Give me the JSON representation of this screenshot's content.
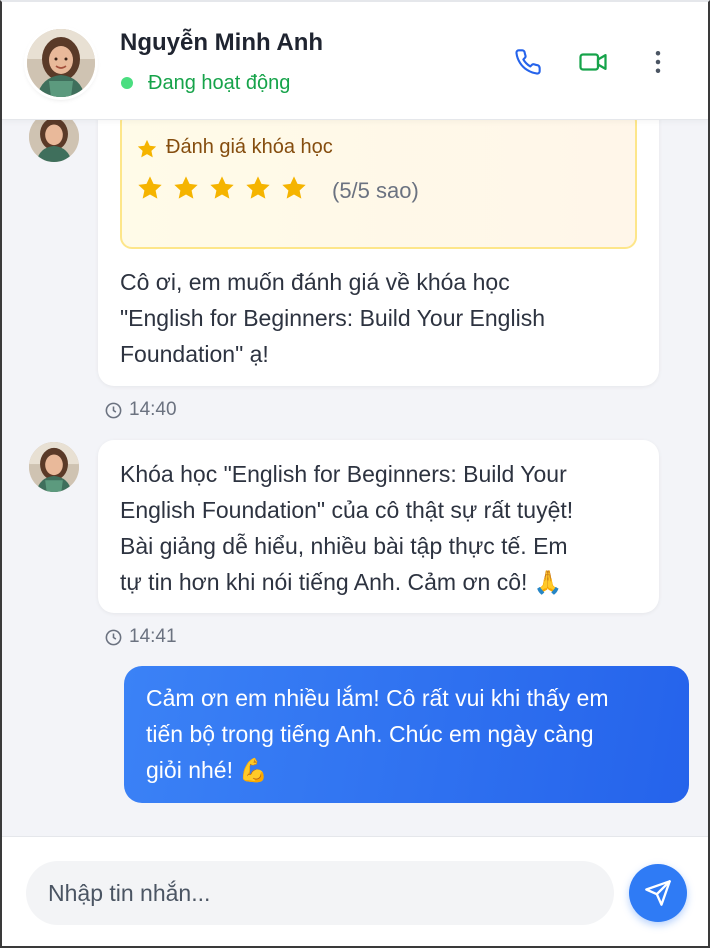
{
  "header": {
    "contact_name": "Nguyễn Minh Anh",
    "status": "Đang hoạt động",
    "icons": [
      "phone-icon",
      "video-icon",
      "more-vertical-icon"
    ]
  },
  "messages": [
    {
      "sender": "contact",
      "rating_card": {
        "title": "Đánh giá khóa học",
        "stars": 5,
        "score_label": "(5/5 sao)"
      },
      "lines": [
        "Cô ơi, em muốn đánh giá về khóa học",
        "\"English for Beginners: Build Your English",
        "Foundation\" ạ!"
      ],
      "time": "14:40"
    },
    {
      "sender": "contact",
      "lines": [
        "Khóa học \"English for Beginners: Build Your",
        "English Foundation\" của cô thật sự rất tuyệt!",
        "Bài giảng dễ hiểu, nhiều bài tập thực tế. Em",
        "tự tin hơn khi nói tiếng Anh. Cảm ơn cô! 🙏"
      ],
      "time": "14:41"
    },
    {
      "sender": "me",
      "lines": [
        "Cảm ơn em nhiều lắm! Cô rất vui khi thấy em",
        "tiến bộ trong tiếng Anh. Chúc em ngày càng",
        "giỏi nhé! 💪"
      ]
    }
  ],
  "composer": {
    "placeholder": "Nhập tin nhắn..."
  },
  "colors": {
    "accent": "#2563eb",
    "online": "#16a34a",
    "star": "#f5b400"
  }
}
